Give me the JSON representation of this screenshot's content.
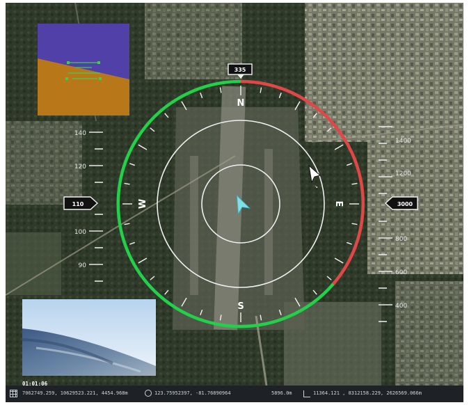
{
  "compass": {
    "heading": "335",
    "cardinals": {
      "north": "N",
      "south": "S",
      "east": "E",
      "west": "W"
    }
  },
  "speed_tape": {
    "current": "110",
    "labels": [
      "140",
      "120",
      "100",
      "90"
    ]
  },
  "altitude_tape": {
    "current": "3000",
    "labels": [
      "1400",
      "1200",
      "800",
      "600",
      "400"
    ]
  },
  "flight_time": "01:01:06",
  "status": {
    "position": "7062749.259, 10629523.221, 4454.968m",
    "orientation": "123.75952397, -81.76890964",
    "distance": "5896.0m",
    "target": "11364.121 , 8312158.229, 2626569.066m"
  },
  "colors": {
    "arc_green": "#22d04a",
    "arc_red": "#e04848",
    "aircraft": "#7ee0ea",
    "sky": "#5040a8",
    "ground": "#b8781a"
  }
}
